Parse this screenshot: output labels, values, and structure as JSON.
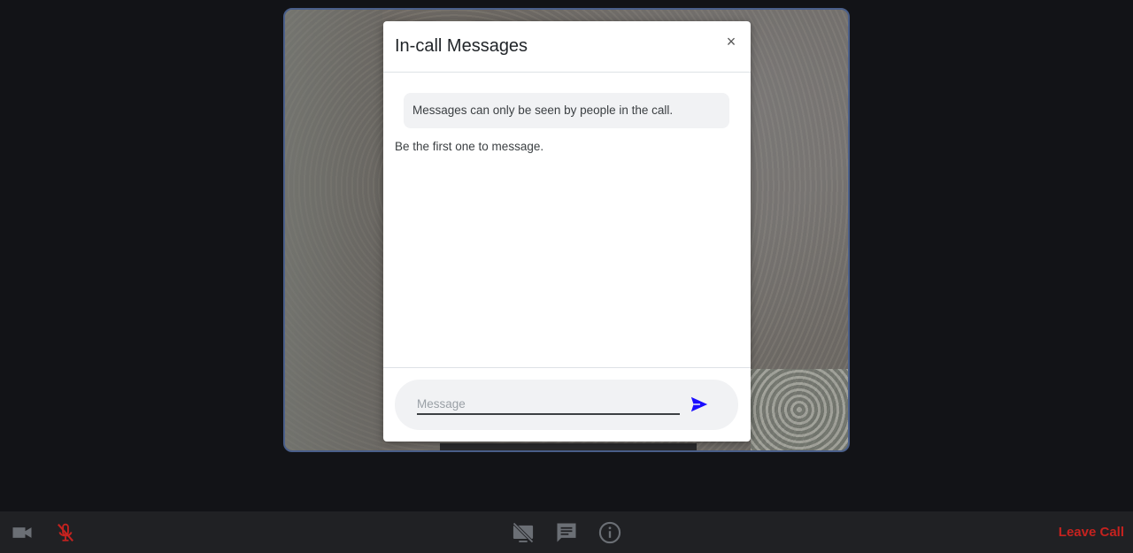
{
  "modal": {
    "title": "In-call Messages",
    "close_symbol": "×",
    "notice": "Messages can only be seen by people in the call.",
    "empty_text": "Be the first one to message.",
    "input_placeholder": "Message",
    "input_value": ""
  },
  "toolbar": {
    "leave_label": "Leave Call",
    "icons": [
      "camera-icon",
      "mic-off-icon",
      "screen-share-off-icon",
      "chat-icon",
      "info-icon"
    ]
  },
  "colors": {
    "send": "#1a0dff",
    "leave": "#c5221f",
    "mic_off": "#c5221f",
    "toolbar_bg": "#202124",
    "page_bg": "#121317"
  }
}
